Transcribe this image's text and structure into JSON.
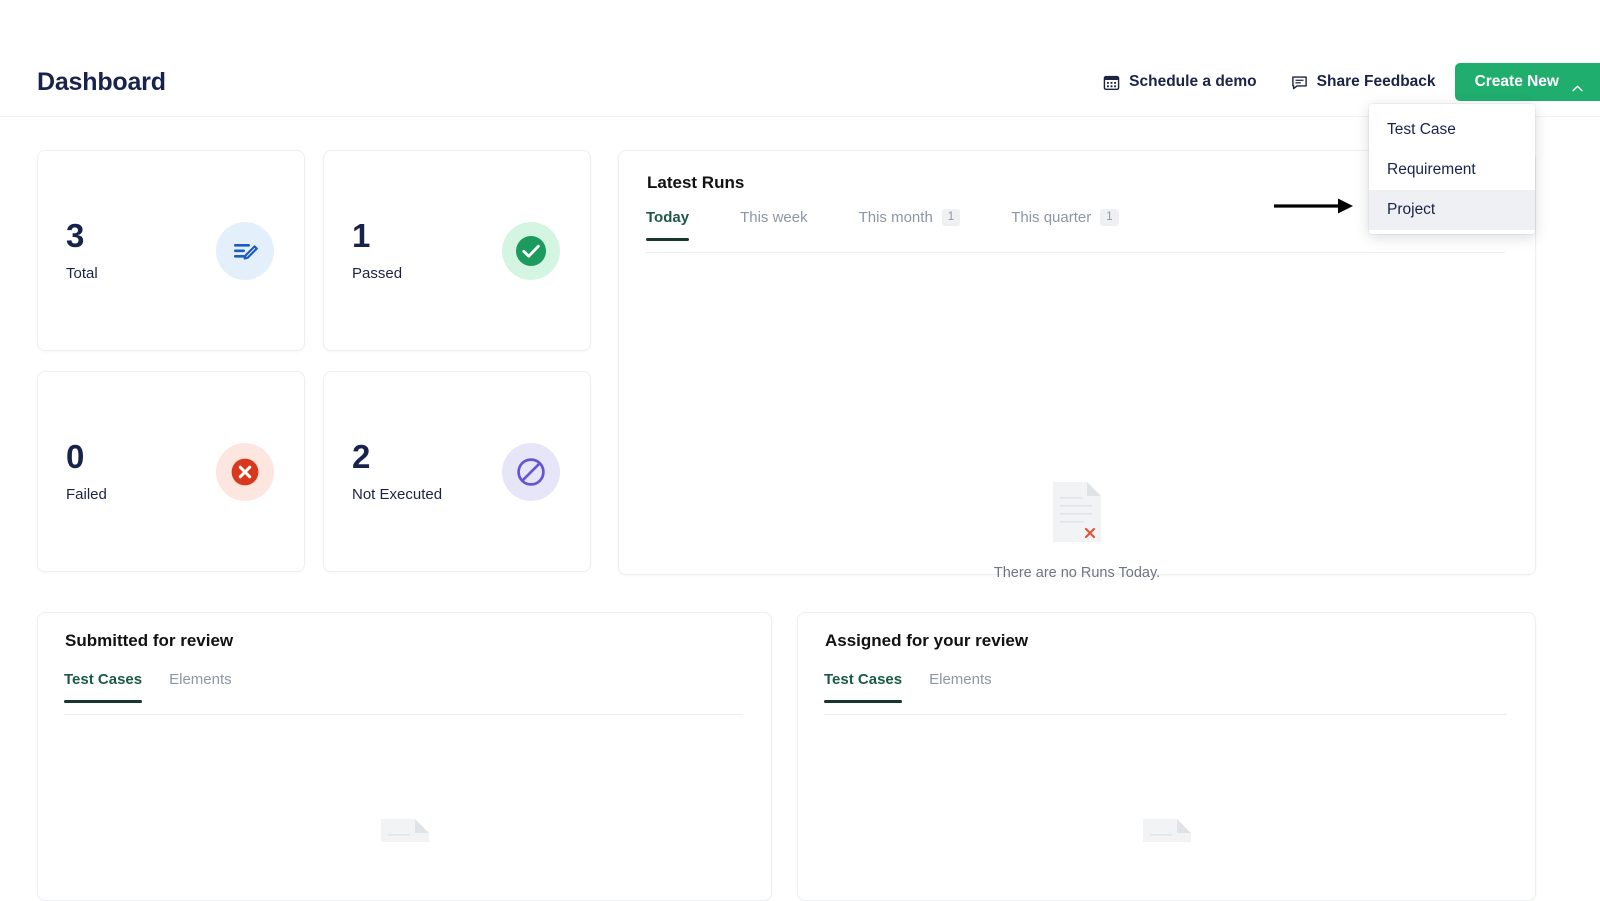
{
  "header": {
    "title": "Dashboard",
    "schedule_label": "Schedule a demo",
    "schedule_icon": "calendar-icon",
    "feedback_label": "Share Feedback",
    "feedback_icon": "comment-icon",
    "create_label": "Create New",
    "create_icon": "chevron-up-icon",
    "create_color": "#1fae6e"
  },
  "dropdown": {
    "items": [
      {
        "label": "Test Case",
        "active": false
      },
      {
        "label": "Requirement",
        "active": false
      },
      {
        "label": "Project",
        "active": true
      }
    ],
    "highlight_color": "#eef0f3"
  },
  "annotation": {
    "arrow": "right-arrow-annotation",
    "color": "#000000"
  },
  "stats": [
    {
      "value": "3",
      "label": "Total",
      "icon": "document-edit-icon",
      "badge_bg": "#e4effc",
      "icon_color": "#1d5bbf"
    },
    {
      "value": "1",
      "label": "Passed",
      "icon": "check-circle-icon",
      "badge_bg": "#d5f5e3",
      "icon_color": "#1d9b5e"
    },
    {
      "value": "0",
      "label": "Failed",
      "icon": "x-circle-icon",
      "badge_bg": "#fde5e0",
      "icon_color": "#d8381d"
    },
    {
      "value": "2",
      "label": "Not Executed",
      "icon": "no-entry-icon",
      "badge_bg": "#e7e5f8",
      "icon_color": "#6355d4"
    }
  ],
  "latest_runs": {
    "title": "Latest Runs",
    "tabs": [
      {
        "label": "Today",
        "badge": "",
        "active": true
      },
      {
        "label": "This week",
        "badge": "",
        "active": false
      },
      {
        "label": "This month",
        "badge": "1",
        "active": false
      },
      {
        "label": "This quarter",
        "badge": "1",
        "active": false
      }
    ],
    "empty_text": "There are no Runs Today.",
    "empty_icon": "document-error-icon",
    "active_color": "#1c5a43"
  },
  "submitted_panel": {
    "title": "Submitted for review",
    "tabs": [
      {
        "label": "Test Cases",
        "active": true
      },
      {
        "label": "Elements",
        "active": false
      }
    ],
    "empty_icon": "document-error-icon"
  },
  "assigned_panel": {
    "title": "Assigned for your review",
    "tabs": [
      {
        "label": "Test Cases",
        "active": true
      },
      {
        "label": "Elements",
        "active": false
      }
    ],
    "empty_icon": "document-error-icon"
  }
}
